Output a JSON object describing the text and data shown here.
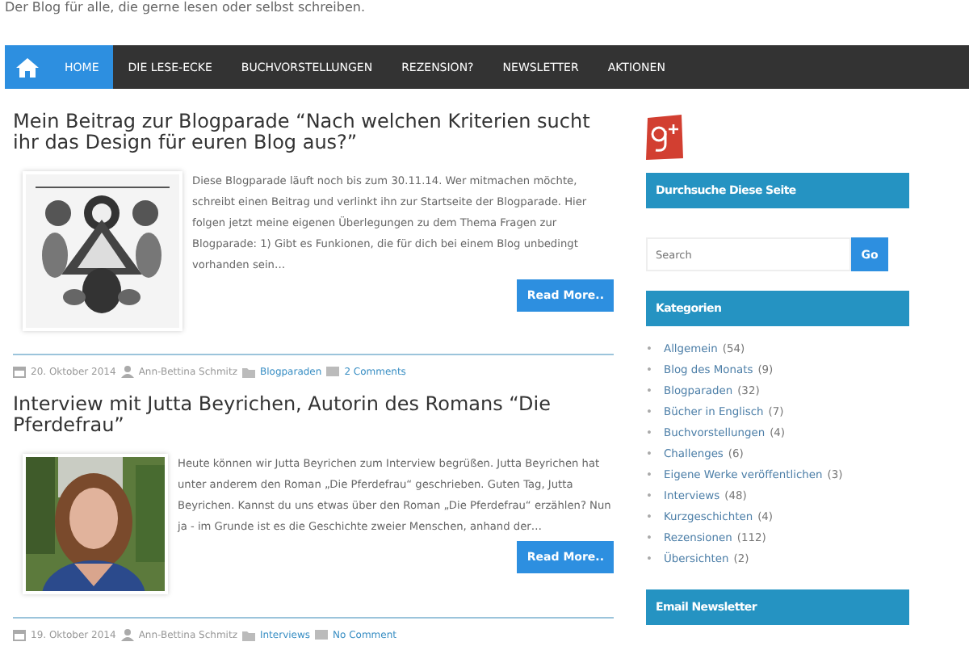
{
  "tagline": "Der Blog für alle, die gerne lesen oder selbst schreiben.",
  "nav": [
    {
      "label": "HOME",
      "selected": true
    },
    {
      "label": "DIE LESE-ECKE",
      "selected": false
    },
    {
      "label": "BUCHVORSTELLUNGEN",
      "selected": false
    },
    {
      "label": "REZENSION?",
      "selected": false
    },
    {
      "label": "NEWSLETTER",
      "selected": false
    },
    {
      "label": "AKTIONEN",
      "selected": false
    }
  ],
  "posts": [
    {
      "title": "Mein Beitrag zur Blogparade “Nach welchen Kriterien sucht ihr das Design für euren Blog aus?”",
      "excerpt": "Diese Blogparade läuft noch bis zum 30.11.14. Wer mitmachen möchte, schreibt einen Beitrag und verlinkt ihn zur Startseite der Blogparade. Hier folgen jetzt meine eigenen Überlegungen zu dem Thema Fragen zur Blogparade: 1) Gibt es Funkionen, die für dich bei einem Blog unbedingt vorhanden sein…",
      "button": "Read More..",
      "date": "20. Oktober 2014",
      "author": "Ann-Bettina Schmitz",
      "category": "Blogparaden",
      "comments": "2 Comments"
    },
    {
      "title": "Interview mit Jutta Beyrichen, Autorin des Romans “Die Pferdefrau”",
      "excerpt": "Heute können wir Jutta Beyrichen zum Interview begrüßen. Jutta Beyrichen hat unter anderem den Roman „Die Pferdefrau“ geschrieben. Guten Tag, Jutta Beyrichen. Kannst du uns etwas über den Roman „Die Pferdefrau“ erzählen? Nun ja - im Grunde ist es die Geschichte zweier Menschen, anhand der…",
      "button": "Read More..",
      "date": "19. Oktober 2014",
      "author": "Ann-Bettina Schmitz",
      "category": "Interviews",
      "comments": "No Comment"
    }
  ],
  "sidebar": {
    "search_heading": "Durchsuche Diese Seite",
    "search": {
      "placeholder": "Search",
      "button": "Go"
    },
    "categories_heading": "Kategorien",
    "categories": [
      {
        "bullet": "•",
        "name": "Allgemein",
        "count": "(54)"
      },
      {
        "bullet": "•",
        "name": "Blog des Monats",
        "count": "(9)"
      },
      {
        "bullet": "•",
        "name": "Blogparaden",
        "count": "(32)"
      },
      {
        "bullet": "•",
        "name": "Bücher in Englisch",
        "count": "(7)"
      },
      {
        "bullet": "•",
        "name": "Buchvorstellungen",
        "count": "(4)"
      },
      {
        "bullet": "•",
        "name": "Challenges",
        "count": "(6)"
      },
      {
        "bullet": "•",
        "name": "Eigene Werke veröffentlichen",
        "count": "(3)"
      },
      {
        "bullet": "•",
        "name": "Interviews",
        "count": "(48)"
      },
      {
        "bullet": "•",
        "name": "Kurzgeschichten",
        "count": "(4)"
      },
      {
        "bullet": "•",
        "name": "Rezensionen",
        "count": "(112)"
      },
      {
        "bullet": "•",
        "name": "Übersichten",
        "count": "(2)"
      }
    ],
    "newsletter_heading": "Email Newsletter"
  }
}
